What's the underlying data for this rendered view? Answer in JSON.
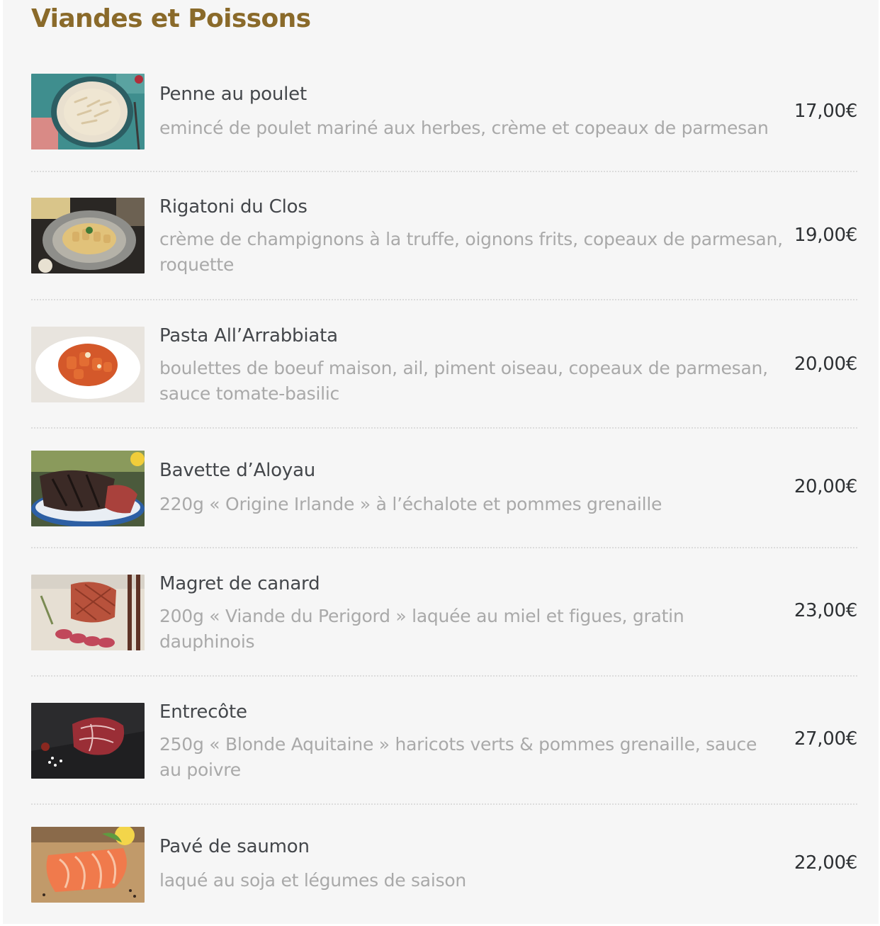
{
  "section": {
    "title": "Viandes et Poissons"
  },
  "items": [
    {
      "name": "Penne au poulet",
      "description": "emincé de poulet mariné aux herbes, crème et copeaux de parmesan",
      "price": "17,00€",
      "photo_icon": "pasta-chicken-photo"
    },
    {
      "name": "Rigatoni du Clos",
      "description": "crème de champignons à la truffe, oignons frits, copeaux de parmesan, roquette",
      "price": "19,00€",
      "photo_icon": "rigatoni-photo"
    },
    {
      "name": "Pasta All’Arrabbiata",
      "description": "boulettes de boeuf maison, ail, piment oiseau, copeaux de parmesan, sauce tomate-basilic",
      "price": "20,00€",
      "photo_icon": "arrabbiata-photo"
    },
    {
      "name": "Bavette d’Aloyau",
      "description": "220g « Origine Irlande » à l’échalote et pommes grenaille",
      "price": "20,00€",
      "photo_icon": "steak-photo"
    },
    {
      "name": "Magret de canard",
      "description": "200g « Viande du Perigord » laquée au miel et figues, gratin dauphinois",
      "price": "23,00€",
      "photo_icon": "duck-breast-photo"
    },
    {
      "name": "Entrecôte",
      "description": "250g «  Blonde Aquitaine » haricots verts & pommes grenaille, sauce au poivre",
      "price": "27,00€",
      "photo_icon": "ribeye-photo"
    },
    {
      "name": "Pavé de saumon",
      "description": "laqué au soja et légumes de saison",
      "price": "22,00€",
      "photo_icon": "salmon-photo"
    }
  ],
  "colors": {
    "title": "#8a6a2a",
    "name": "#44474b",
    "description": "#a9a9a9",
    "price": "#2e3134",
    "background": "#f6f6f6"
  }
}
